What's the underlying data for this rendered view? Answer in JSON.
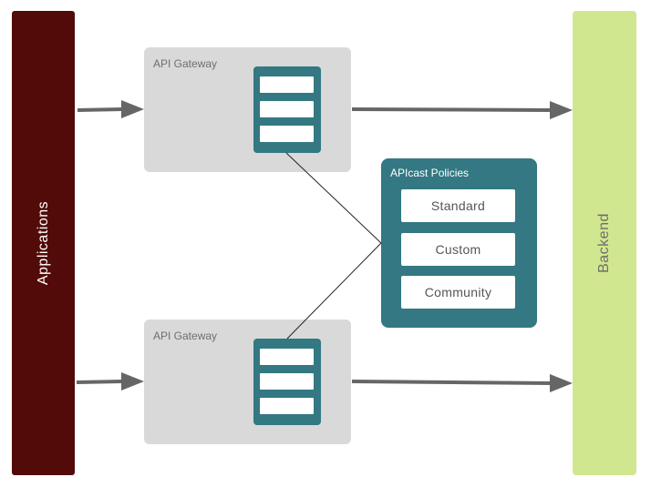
{
  "applications": {
    "label": "Applications",
    "color": "#520b08"
  },
  "backend": {
    "label": "Backend",
    "color": "#d1e78f"
  },
  "gateways": [
    {
      "title": "API Gateway"
    },
    {
      "title": "API Gateway"
    }
  ],
  "policies": {
    "title": "APIcast Policies",
    "items": [
      "Standard",
      "Custom",
      "Community"
    ],
    "color": "#337882"
  },
  "colors": {
    "gateway_bg": "#d9d9d9",
    "arrow": "#666666"
  }
}
